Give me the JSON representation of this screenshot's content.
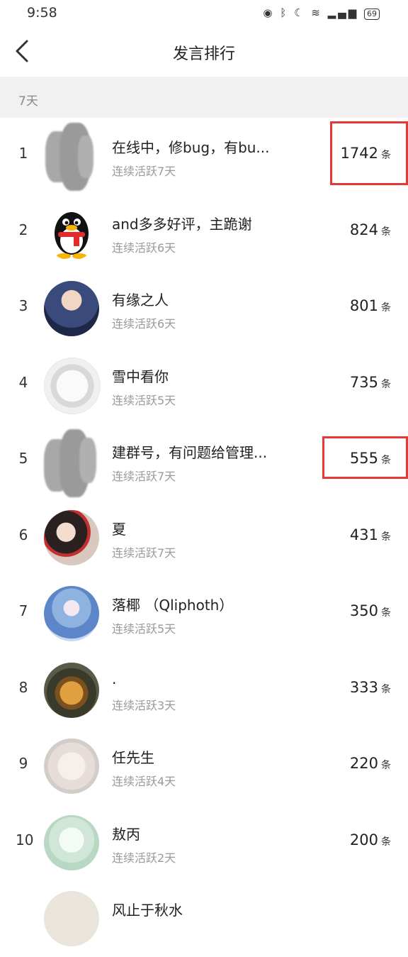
{
  "status_bar": {
    "time": "9:58",
    "icons": [
      "eye-icon",
      "bluetooth-icon",
      "moon-icon",
      "wifi-icon",
      "signal-icon"
    ],
    "battery": "69"
  },
  "nav": {
    "title": "发言排行",
    "back_icon": "chevron-left-icon"
  },
  "section": {
    "label": "7天"
  },
  "count_unit": "条",
  "colors": {
    "highlight": "#e53935",
    "section_bg": "#f1f1f1",
    "secondary_text": "#9a9a9a"
  },
  "rankings": [
    {
      "rank": "1",
      "name": "在线中，修bug，有bu...",
      "active": "连续活跃7天",
      "count": "1742",
      "avatar": "blurred-avatar",
      "highlighted": true
    },
    {
      "rank": "2",
      "name": "and多多好评，主跪谢",
      "active": "连续活跃6天",
      "count": "824",
      "avatar": "qq-penguin-avatar",
      "highlighted": false
    },
    {
      "rank": "3",
      "name": "有缘之人",
      "active": "连续活跃6天",
      "count": "801",
      "avatar": "anime-boy-avatar",
      "highlighted": false
    },
    {
      "rank": "4",
      "name": "雪中看你",
      "active": "连续活跃5天",
      "count": "735",
      "avatar": "sketch-girl-avatar",
      "highlighted": false
    },
    {
      "rank": "5",
      "name": "建群号，有问题给管理...",
      "active": "连续活跃7天",
      "count": "555",
      "avatar": "blurred-avatar",
      "highlighted": true
    },
    {
      "rank": "6",
      "name": "夏",
      "active": "连续活跃7天",
      "count": "431",
      "avatar": "anime-girl-avatar",
      "highlighted": false
    },
    {
      "rank": "7",
      "name": "落椰 （Qliphoth）",
      "active": "连续活跃5天",
      "count": "350",
      "avatar": "blue-hair-avatar",
      "highlighted": false
    },
    {
      "rank": "8",
      "name": ".",
      "active": "连续活跃3天",
      "count": "333",
      "avatar": "dog-avatar",
      "highlighted": false
    },
    {
      "rank": "9",
      "name": "任先生",
      "active": "连续活跃4天",
      "count": "220",
      "avatar": "shirt-avatar",
      "highlighted": false
    },
    {
      "rank": "10",
      "name": "敖丙",
      "active": "连续活跃2天",
      "count": "200",
      "avatar": "line-art-avatar",
      "highlighted": false
    },
    {
      "rank": "",
      "name": "风止于秋水",
      "active": "",
      "count": "",
      "avatar": "partial-avatar",
      "highlighted": false
    }
  ]
}
